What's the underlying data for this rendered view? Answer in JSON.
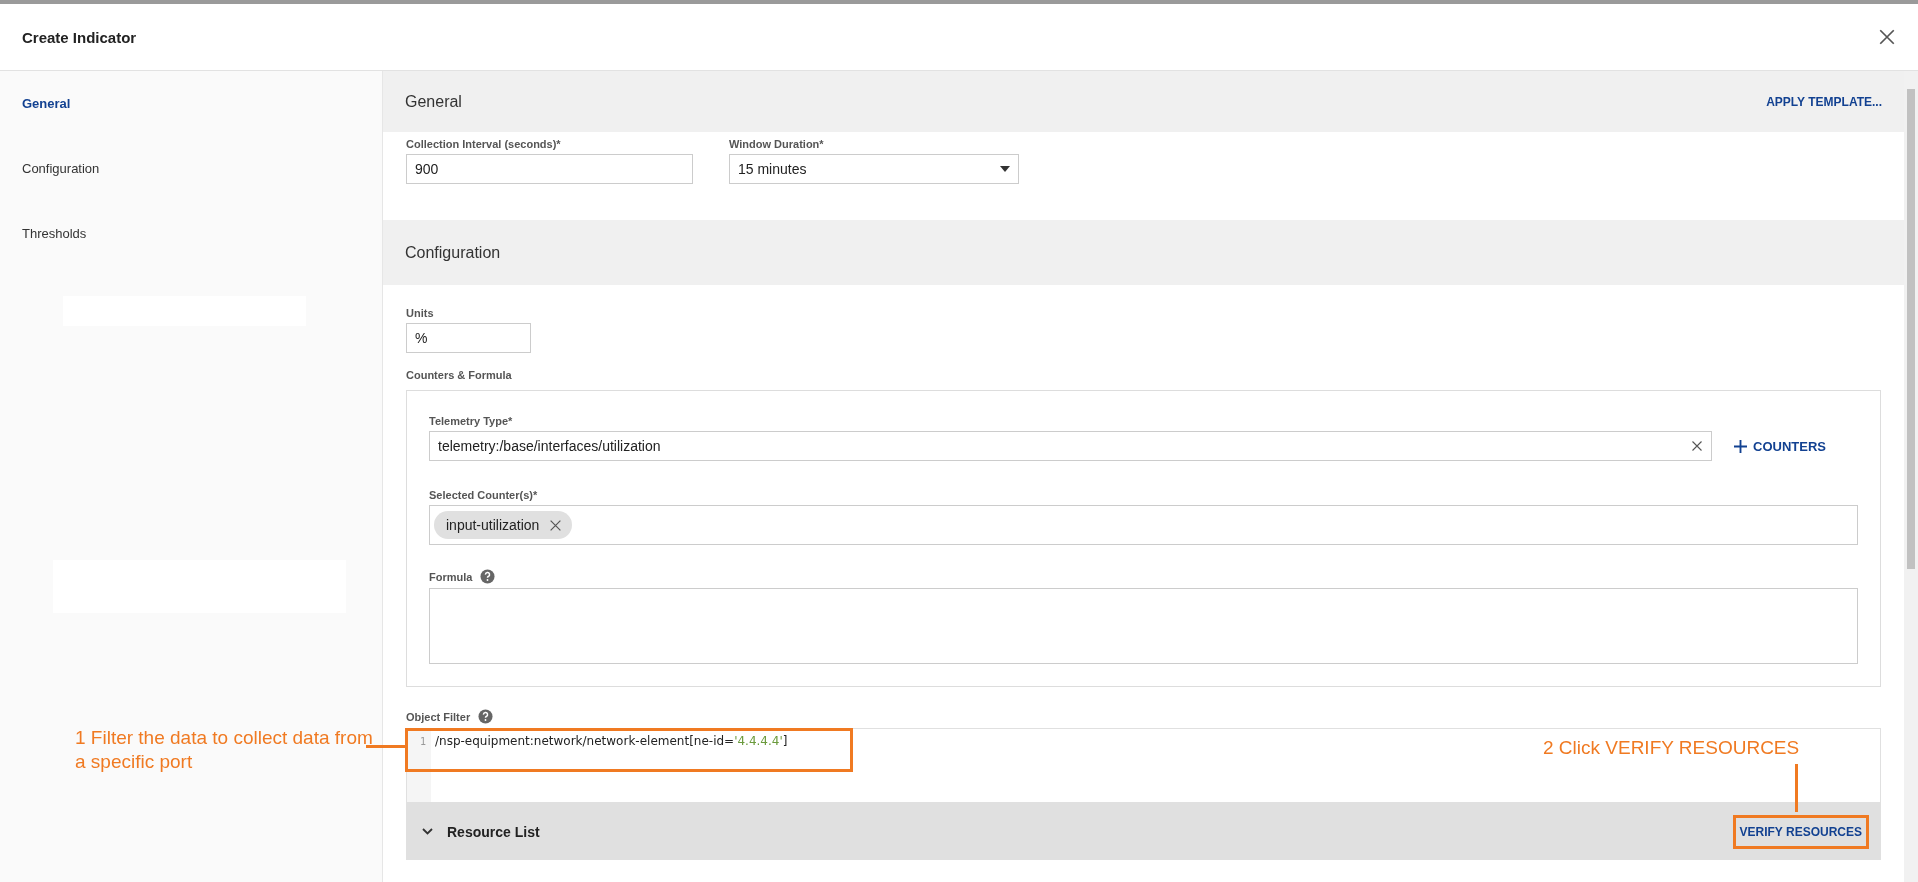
{
  "dialog": {
    "title": "Create Indicator"
  },
  "nav": [
    {
      "label": "General",
      "selected": true
    },
    {
      "label": "Configuration",
      "selected": false
    },
    {
      "label": "Thresholds",
      "selected": false
    }
  ],
  "general": {
    "title": "General",
    "action": "APPLY TEMPLATE...",
    "fields": [
      {
        "label": "Collection Interval (seconds)*",
        "value": "900",
        "kind": "text"
      },
      {
        "label": "Window Duration*",
        "value": "15 minutes",
        "kind": "select"
      }
    ]
  },
  "configuration": {
    "title": "Configuration",
    "units": {
      "label": "Units",
      "value": "%"
    },
    "counters_formula": {
      "label": "Counters & Formula",
      "telemetry_type": {
        "label": "Telemetry Type*",
        "value": "telemetry:/base/interfaces/utilization"
      },
      "add_counters": "COUNTERS",
      "selected_counters": {
        "label": "Selected Counter(s)*",
        "chips": [
          "input-utilization"
        ]
      },
      "formula": {
        "label": "Formula"
      }
    },
    "object_filter": {
      "label": "Object Filter",
      "lines": [
        {
          "number": "1",
          "code": "/nsp-equipment:network/network-element[ne-id=",
          "string": "'4.4.4.4'",
          "end": "]"
        }
      ]
    },
    "resource_list": {
      "title": "Resource List",
      "action": "VERIFY RESOURCES"
    }
  },
  "annotations": [
    {
      "text": "1 Filter the data to collect data from a specific port"
    },
    {
      "text": "2 Click VERIFY RESOURCES"
    }
  ]
}
